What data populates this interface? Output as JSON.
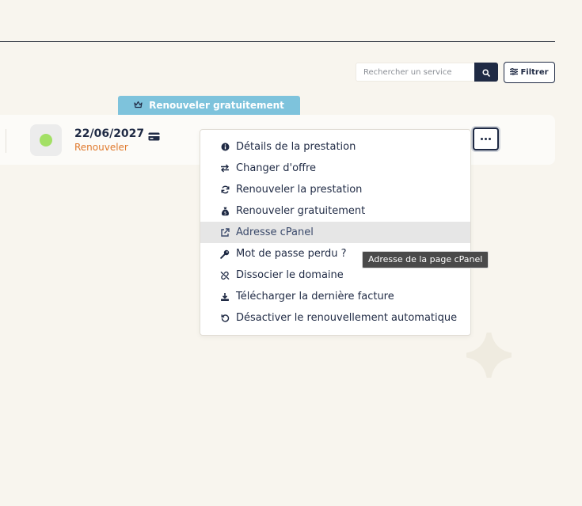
{
  "search": {
    "placeholder": "Rechercher un service",
    "icon": "search-icon"
  },
  "filter": {
    "label": "Filtrer",
    "icon": "sliders-icon"
  },
  "banner": {
    "label": "Renouveler gratuitement",
    "icon": "crown-icon"
  },
  "service": {
    "status_color": "#a3e065",
    "expiry_date": "22/06/2027",
    "renew_label": "Renouveler",
    "renew_color": "#e07a2e"
  },
  "menu": {
    "items": [
      {
        "label": "Détails de la prestation",
        "icon": "info-icon"
      },
      {
        "label": "Changer d'offre",
        "icon": "swap-icon"
      },
      {
        "label": "Renouveler la prestation",
        "icon": "refresh-icon"
      },
      {
        "label": "Renouveler gratuitement",
        "icon": "money-bag-icon"
      },
      {
        "label": "Adresse cPanel",
        "icon": "external-link-icon"
      },
      {
        "label": "Mot de passe perdu ?",
        "icon": "key-icon"
      },
      {
        "label": "Dissocier le domaine",
        "icon": "unlink-icon"
      },
      {
        "label": "Télécharger la dernière facture",
        "icon": "download-icon"
      },
      {
        "label": "Désactiver le renouvellement automatique",
        "icon": "undo-icon"
      }
    ]
  },
  "tooltip": {
    "text": "Adresse de la page cPanel"
  },
  "colors": {
    "primary": "#1f2a44",
    "accent_blue": "#7ec3dc",
    "background": "#f8f5ee"
  }
}
